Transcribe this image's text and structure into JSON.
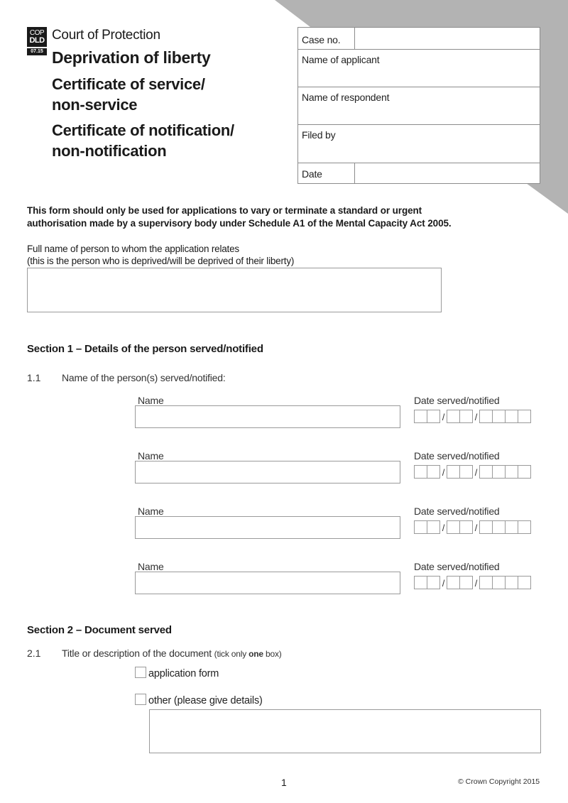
{
  "header": {
    "logo": {
      "line1": "COP",
      "line2": "DLD",
      "version": "07.15"
    },
    "court": "Court of Protection",
    "title": "Deprivation of liberty",
    "subtitle1_line1": "Certificate of service/",
    "subtitle1_line2": "non-service",
    "subtitle2_line1": "Certificate of notification/",
    "subtitle2_line2": "non-notification"
  },
  "case_box": {
    "case_no": {
      "label": "Case no.",
      "value": ""
    },
    "applicant": {
      "label": "Name of applicant",
      "value": ""
    },
    "respondent": {
      "label": "Name of respondent",
      "value": ""
    },
    "filed_by": {
      "label": "Filed by",
      "value": ""
    },
    "date": {
      "label": "Date",
      "value": ""
    }
  },
  "intro": {
    "line1": "This form should only be used for applications to vary or terminate a standard or urgent",
    "line2": "authorisation made by a supervisory body under Schedule A1 of the Mental Capacity Act 2005."
  },
  "full_name": {
    "label_line1": "Full name of person to whom the application relates",
    "label_line2": "(this is the person who is deprived/will be deprived of their liberty)",
    "value": ""
  },
  "section1": {
    "heading": "Section 1 – Details of the person served/notified",
    "q_num": "1.1",
    "q_text": "Name of the person(s) served/notified:",
    "entries": [
      {
        "name_label": "Name",
        "name_value": "",
        "date_label": "Date served/notified",
        "date_sep": "/"
      },
      {
        "name_label": "Name",
        "name_value": "",
        "date_label": "Date served/notified",
        "date_sep": "/"
      },
      {
        "name_label": "Name",
        "name_value": "",
        "date_label": "Date served/notified",
        "date_sep": "/"
      },
      {
        "name_label": "Name",
        "name_value": "",
        "date_label": "Date served/notified",
        "date_sep": "/"
      }
    ]
  },
  "section2": {
    "heading": "Section 2 – Document served",
    "q_num": "2.1",
    "q_text": "Title or description of the document",
    "q_hint_pre": "(tick only ",
    "q_hint_bold": "one",
    "q_hint_post": " box)",
    "options": [
      {
        "label": "application form",
        "checked": false
      },
      {
        "label": "other (please give details)",
        "checked": false
      }
    ],
    "details_value": ""
  },
  "footer": {
    "page_number": "1",
    "copyright": "© Crown Copyright 2015"
  },
  "colors": {
    "corner_gray": "#b3b3b3",
    "border": "#8c8c8c",
    "logo_bg": "#1a1a1a"
  }
}
